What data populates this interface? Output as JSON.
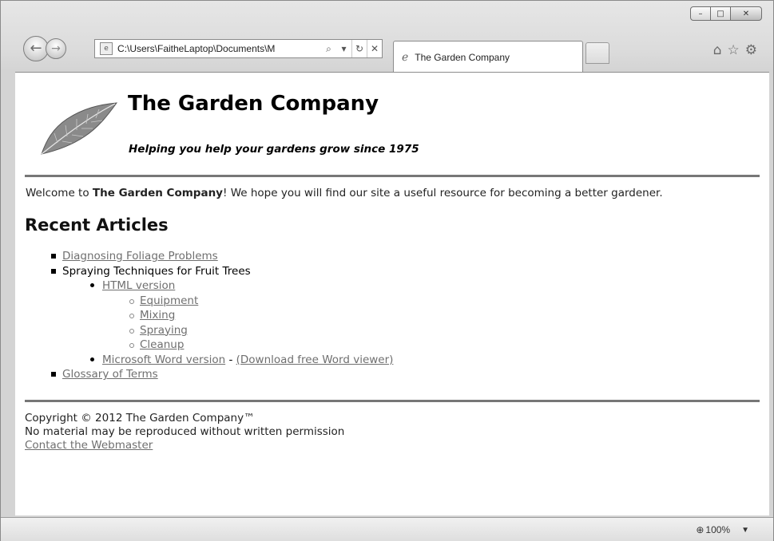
{
  "browser": {
    "address": "C:\\Users\\FaitheLaptop\\Documents\\M",
    "tab_title": "The Garden Company",
    "zoom": "100%",
    "caption": {
      "minimize": "–",
      "maximize": "□",
      "close": "✕"
    }
  },
  "header": {
    "title": "The Garden Company",
    "tagline": "Helping you help your gardens grow since 1975"
  },
  "welcome": {
    "before": "Welcome to ",
    "bold": "The Garden Company",
    "after": "! We hope you will find our site a useful resource for becoming a better gardener."
  },
  "recent": {
    "title": "Recent Articles",
    "item1": "Diagnosing Foliage Problems",
    "item2": "Spraying Techniques for Fruit Trees",
    "html_version": "HTML version",
    "sub": [
      "Equipment",
      "Mixing",
      "Spraying",
      "Cleanup"
    ],
    "word_version": "Microsoft Word version",
    "separator": " - ",
    "download": "(Download free Word viewer)",
    "item3": "Glossary of Terms"
  },
  "footer": {
    "copyright": "Copyright © 2012 The Garden Company™",
    "notice": "No material may be reproduced without written permission",
    "contact": "Contact the Webmaster"
  }
}
